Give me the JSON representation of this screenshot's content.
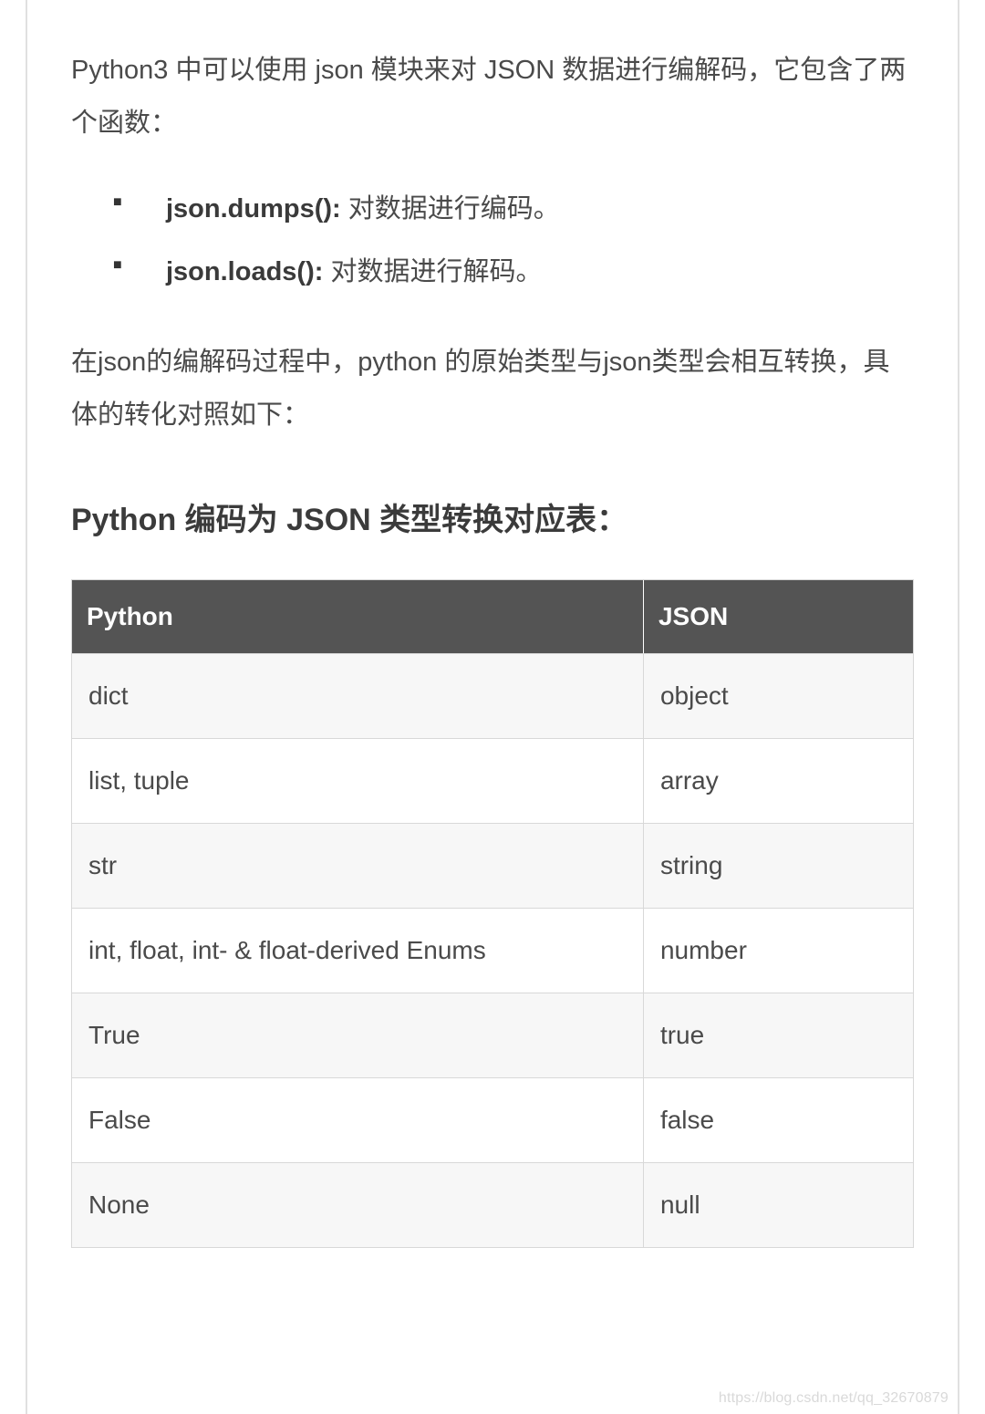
{
  "intro": "Python3 中可以使用 json 模块来对 JSON 数据进行编解码，它包含了两个函数：",
  "bullets": [
    {
      "bold": "json.dumps():",
      "rest": " 对数据进行编码。"
    },
    {
      "bold": "json.loads():",
      "rest": " 对数据进行解码。"
    }
  ],
  "desc": "在json的编解码过程中，python 的原始类型与json类型会相互转换，具体的转化对照如下：",
  "heading": "Python 编码为 JSON 类型转换对应表：",
  "table": {
    "headers": {
      "python": "Python",
      "json": "JSON"
    },
    "rows": [
      {
        "python": "dict",
        "json": "object"
      },
      {
        "python": "list, tuple",
        "json": "array"
      },
      {
        "python": "str",
        "json": "string"
      },
      {
        "python": "int, float, int- & float-derived Enums",
        "json": "number"
      },
      {
        "python": "True",
        "json": "true"
      },
      {
        "python": "False",
        "json": "false"
      },
      {
        "python": "None",
        "json": "null"
      }
    ]
  },
  "watermark": "https://blog.csdn.net/qq_32670879"
}
